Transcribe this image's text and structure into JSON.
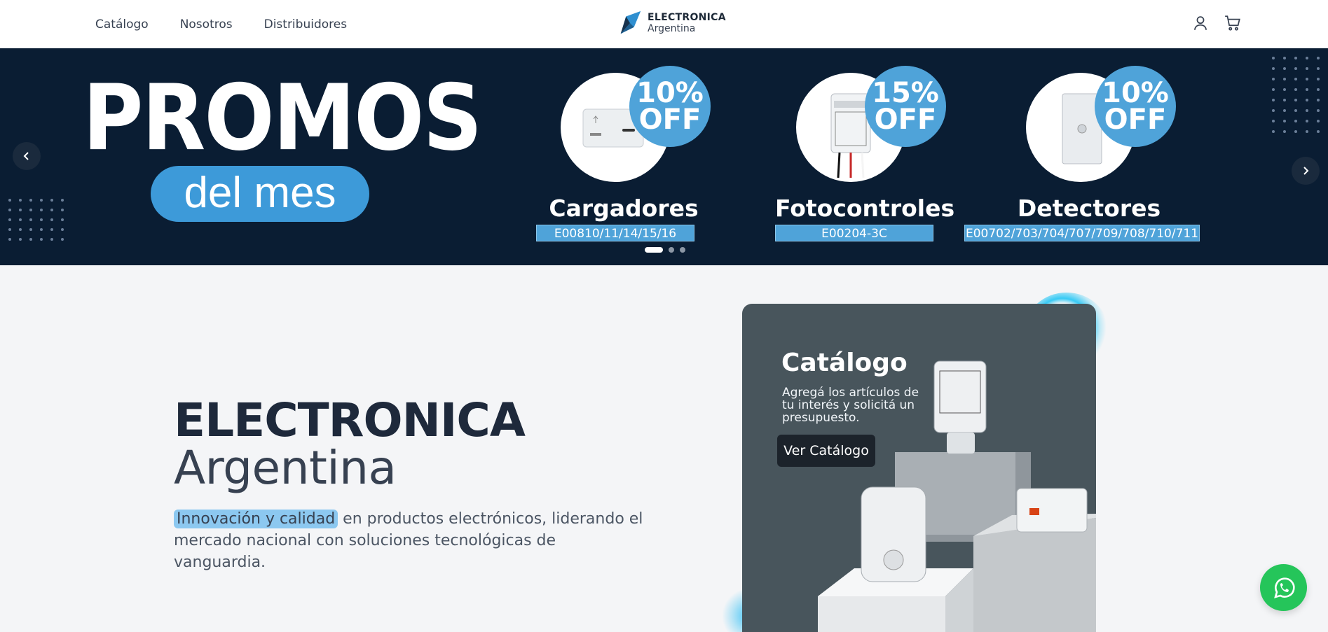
{
  "header": {
    "nav": [
      {
        "label": "Catálogo"
      },
      {
        "label": "Nosotros"
      },
      {
        "label": "Distribuidores"
      }
    ],
    "logo": {
      "brand": "ELECTRONICA",
      "sub": "Argentina"
    },
    "icons": [
      "user-icon",
      "cart-icon"
    ]
  },
  "banner": {
    "headline": "PROMOS",
    "subheadline": "del mes",
    "products": [
      {
        "discount_value": "10%",
        "discount_label": "OFF",
        "name": "Cargadores",
        "codes": "E00810/11/14/15/16"
      },
      {
        "discount_value": "15%",
        "discount_label": "OFF",
        "name": "Fotocontroles",
        "codes": "E00204-3C"
      },
      {
        "discount_value": "10%",
        "discount_label": "OFF",
        "name": "Detectores",
        "codes": "E00702/703/704/707/709/708/710/711"
      }
    ],
    "slides_total": 3,
    "active_slide": 1,
    "colors": {
      "background": "#0a1d33",
      "accent": "#4fa3d9"
    }
  },
  "hero": {
    "title": "ELECTRONICA",
    "subtitle": "Argentina",
    "highlight": "Innovación y calidad",
    "description": " en productos electrónicos, liderando el mercado nacional con soluciones tecnológicas de vanguardia."
  },
  "catalog_card": {
    "title": "Catálogo",
    "description": "Agregá los artículos de tu interés y solicitá un presupuesto.",
    "button": "Ver Catálogo"
  },
  "whatsapp": {
    "icon": "whatsapp-icon",
    "color": "#25c55a"
  }
}
